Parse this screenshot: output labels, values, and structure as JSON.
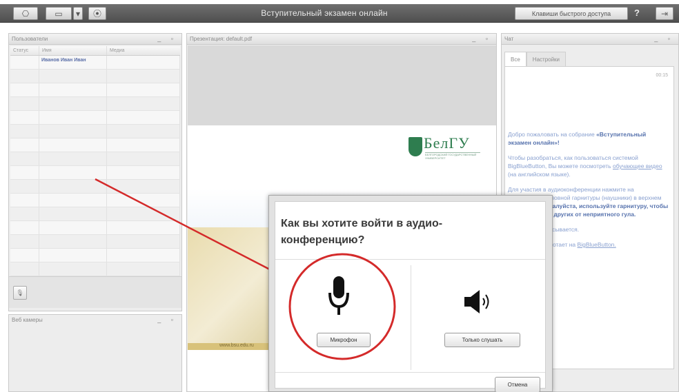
{
  "toolbar": {
    "title": "Вступительный экзамен онлайн",
    "shortcut_label": "Клавиши быстрого доступа",
    "help_label": "?",
    "exit_label": "⇥",
    "webcam_label": "⎔",
    "desktop_label": "▭",
    "desktop_dropdown": "▾",
    "settings_label": "⦿"
  },
  "users_panel": {
    "title": "Пользователи",
    "controls": "_ ▫",
    "columns": [
      "Статус",
      "Имя",
      "Медиа"
    ],
    "rows": [
      {
        "name": "Иванов Иван Иван"
      }
    ],
    "mic_button": "🎙"
  },
  "cameras_panel": {
    "title": "Веб камеры",
    "controls": "_ ▫"
  },
  "presentation_panel": {
    "title": "Презентация: default.pdf",
    "controls": "_ ▫",
    "logo_text": "БелГУ",
    "logo_sub": "БЕЛГОРОДСКИЙ ГОСУДАРСТВЕННЫЙ УНИВЕРСИТЕТ",
    "slide_url": "www.bsu.edu.ru"
  },
  "chat_panel": {
    "title": "Чат",
    "controls": "_ ▫",
    "tabs": [
      "Все",
      "Настройки"
    ],
    "time": "00:15",
    "welcome_prefix": "Добро пожаловать на собрание",
    "meeting_name": "«Вступительный экзамен онлайн»!",
    "howto_text": "Чтобы разобраться, как пользоваться системой BigBlueButton, Вы можете посмотреть",
    "howto_link": "обучающее видео",
    "howto_suffix": "(на английском языке).",
    "audio_hint": "Для участия в аудиоконференции нажмите на изображение головной гарнитуры (наушники) в верхнем левом углу.",
    "headset_bold": "Пожалуйста, используйте гарнитуру, чтобы уберечь себя и других от неприятного гула.",
    "recording": "Эта сессия записывается.",
    "server_text": "Этот сервер работает на",
    "server_link": "BigBlueButton."
  },
  "audio_dialog": {
    "title": "Как вы хотите войти в аудио-конференцию?",
    "microphone_label": "Микрофон",
    "listen_only_label": "Только слушать",
    "cancel_label": "Отмена"
  },
  "colors": {
    "toolbar": "#5c5c5c",
    "annotation_red": "#d42a2a",
    "link_blue": "#5672ad"
  }
}
